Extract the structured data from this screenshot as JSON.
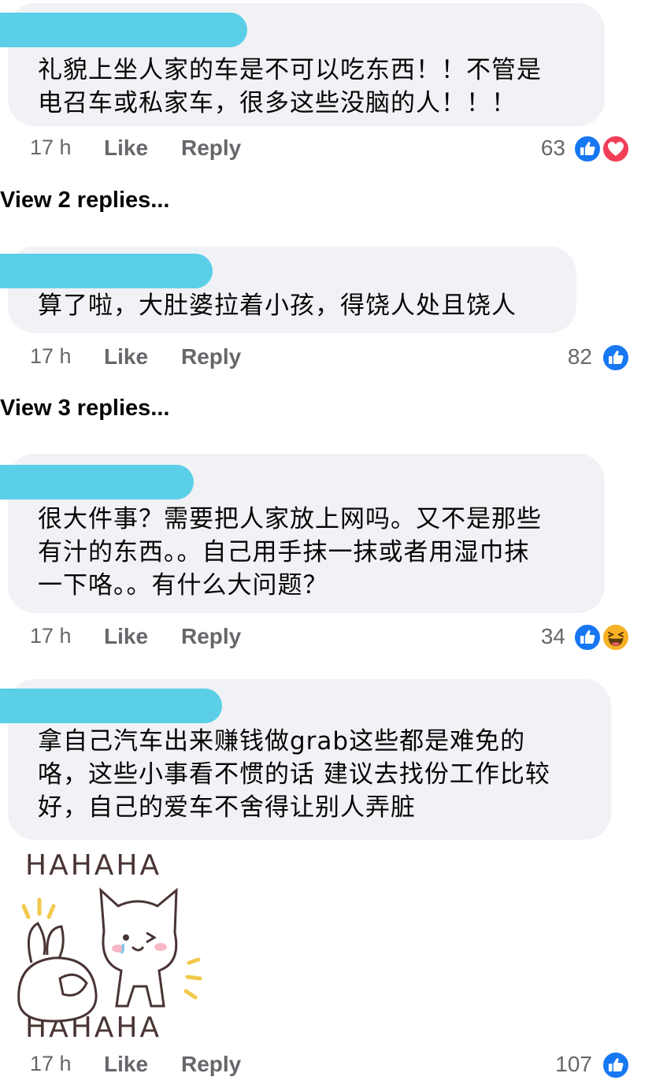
{
  "comments": [
    {
      "text": "礼貌上坐人家的车是不可以吃东西！！不管是\n电召车或私家车，很多这些没脑的人！！！",
      "time": "17 h",
      "like": "Like",
      "reply": "Reply",
      "reaction_count": "63",
      "reactions": [
        "like-icon",
        "love-icon"
      ],
      "view_replies": "View 2 replies..."
    },
    {
      "text": "算了啦，大肚婆拉着小孩，得饶人处且饶人",
      "time": "17 h",
      "like": "Like",
      "reply": "Reply",
      "reaction_count": "82",
      "reactions": [
        "like-icon"
      ],
      "view_replies": "View 3 replies..."
    },
    {
      "text": "很大件事？需要把人家放上网吗。又不是那些\n有汁的东西。。自己用手抹一抹或者用湿巾抹\n一下咯。。有什么大问题？",
      "time": "17 h",
      "like": "Like",
      "reply": "Reply",
      "reaction_count": "34",
      "reactions": [
        "like-icon",
        "haha-icon"
      ]
    },
    {
      "text": "拿自己汽车出来赚钱做grab这些都是难免的\n咯，这些小事看不惯的话 建议去找份工作比较\n好，自己的爱车不舍得让别人弄脏",
      "time": "17 h",
      "like": "Like",
      "reply": "Reply",
      "reaction_count": "107",
      "reactions": [
        "like-icon"
      ],
      "sticker": {
        "top_text": "HAHAHA",
        "bottom_text": "HAHAHA",
        "icon": "laughing-cat-rabbit-sticker"
      }
    }
  ],
  "colors": {
    "bubble": "#f0f2f5",
    "redaction": "#5bcfe8",
    "meta_text": "#65676b",
    "like_blue": "#1877f2",
    "love_red": "#f33e58",
    "haha_yellow": "#f7b125"
  }
}
